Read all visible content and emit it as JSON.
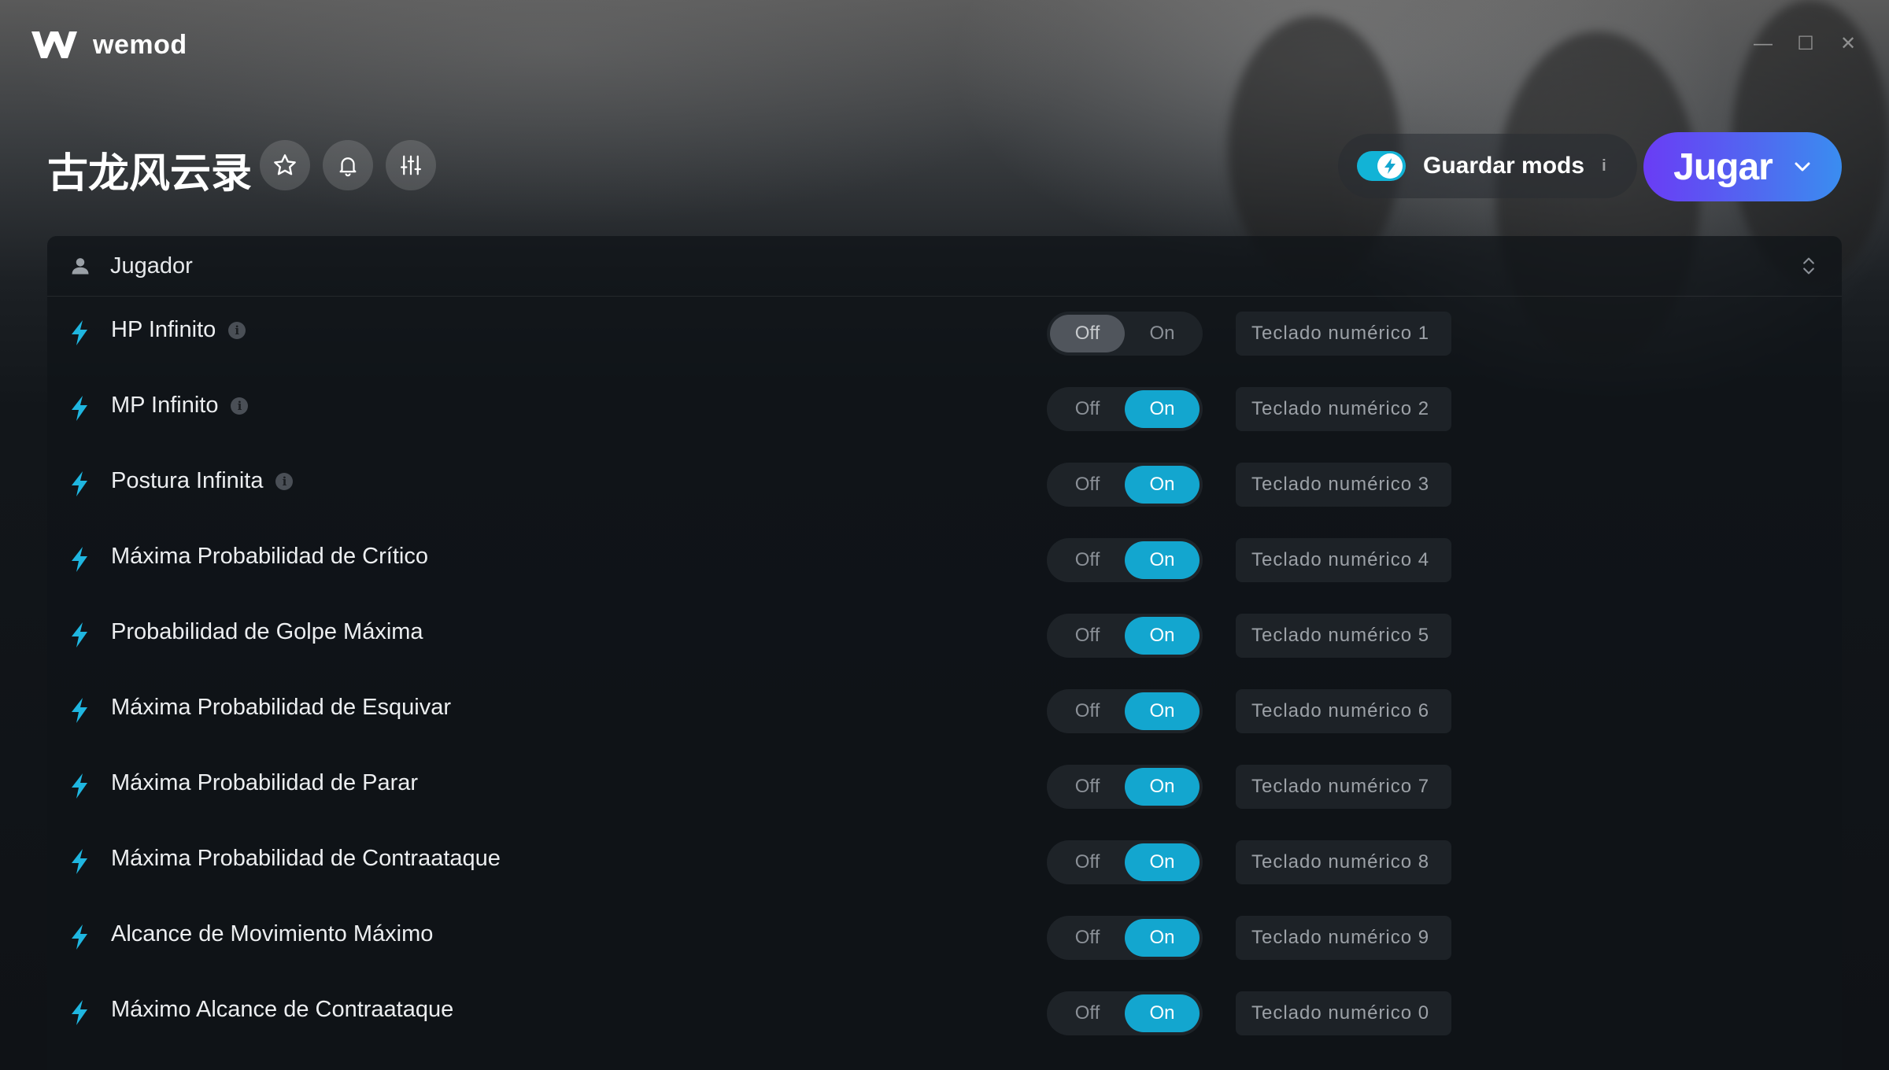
{
  "app": {
    "name": "wemod"
  },
  "window": {
    "minimize": "—",
    "maximize": "☐",
    "close": "✕"
  },
  "game": {
    "title": "古龙风云录"
  },
  "header_buttons": {
    "favorite": "star-icon",
    "notify": "bell-icon",
    "settings": "sliders-icon"
  },
  "save_mods": {
    "label": "Guardar mods",
    "info": "i",
    "enabled": true
  },
  "play": {
    "label": "Jugar"
  },
  "colors": {
    "accent": "#13a6cf",
    "play_start": "#6a3cf5",
    "play_end": "#3a8df0"
  },
  "section": {
    "title": "Jugador"
  },
  "switch_labels": {
    "off": "Off",
    "on": "On"
  },
  "mods": [
    {
      "name": "HP Infinito",
      "has_info": true,
      "state": "off",
      "hotkey": "Teclado numérico 1"
    },
    {
      "name": "MP Infinito",
      "has_info": true,
      "state": "on",
      "hotkey": "Teclado numérico 2"
    },
    {
      "name": "Postura Infinita",
      "has_info": true,
      "state": "on",
      "hotkey": "Teclado numérico 3"
    },
    {
      "name": "Máxima Probabilidad de Crítico",
      "has_info": false,
      "state": "on",
      "hotkey": "Teclado numérico 4"
    },
    {
      "name": "Probabilidad de Golpe Máxima",
      "has_info": false,
      "state": "on",
      "hotkey": "Teclado numérico 5"
    },
    {
      "name": "Máxima Probabilidad de Esquivar",
      "has_info": false,
      "state": "on",
      "hotkey": "Teclado numérico 6"
    },
    {
      "name": "Máxima Probabilidad de Parar",
      "has_info": false,
      "state": "on",
      "hotkey": "Teclado numérico 7"
    },
    {
      "name": "Máxima Probabilidad de Contraataque",
      "has_info": false,
      "state": "on",
      "hotkey": "Teclado numérico 8"
    },
    {
      "name": "Alcance de Movimiento Máximo",
      "has_info": false,
      "state": "on",
      "hotkey": "Teclado numérico 9"
    },
    {
      "name": "Máximo Alcance de Contraataque",
      "has_info": false,
      "state": "on",
      "hotkey": "Teclado numérico 0"
    }
  ]
}
